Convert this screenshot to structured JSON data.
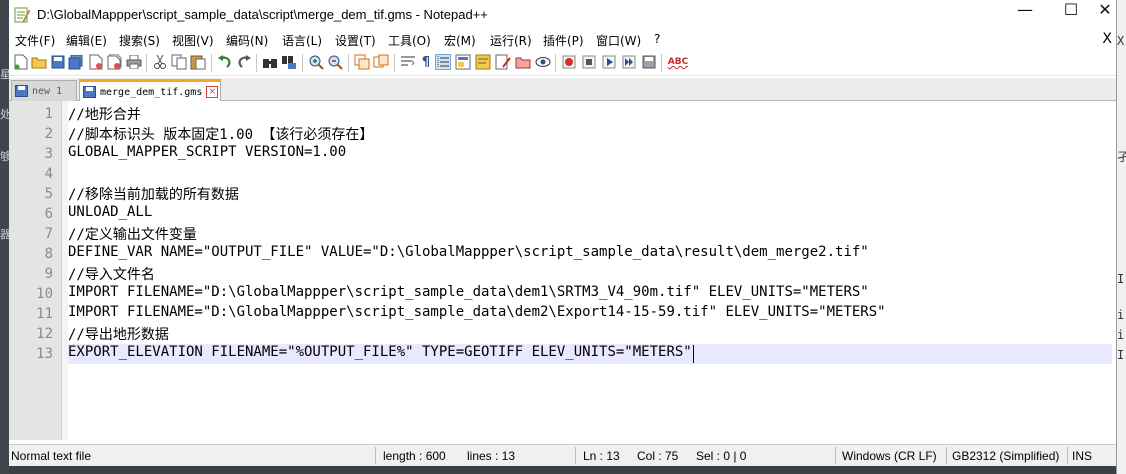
{
  "window": {
    "title": "D:\\GlobalMappper\\script_sample_data\\script\\merge_dem_tif.gms - Notepad++",
    "minimize_glyph": "—",
    "maximize_glyph": "☐",
    "close_glyph": "✕"
  },
  "menu": {
    "items": [
      "文件(F)",
      "编辑(E)",
      "搜索(S)",
      "视图(V)",
      "编码(N)",
      "语言(L)",
      "设置(T)",
      "工具(O)",
      "宏(M)",
      "运行(R)",
      "插件(P)",
      "窗口(W)",
      "?"
    ],
    "close_label": "X"
  },
  "tabs": [
    {
      "label": "new 1",
      "active": false
    },
    {
      "label": "merge_dem_tif.gms",
      "active": true
    }
  ],
  "editor": {
    "line_numbers": [
      "1",
      "2",
      "3",
      "4",
      "5",
      "6",
      "7",
      "8",
      "9",
      "10",
      "11",
      "12",
      "13"
    ],
    "lines": [
      "//地形合并",
      "//脚本标识头 版本固定1.00 【该行必须存在】",
      "GLOBAL_MAPPER_SCRIPT VERSION=1.00",
      "",
      "//移除当前加载的所有数据",
      "UNLOAD_ALL",
      "//定义输出文件变量",
      "DEFINE_VAR NAME=\"OUTPUT_FILE\" VALUE=\"D:\\GlobalMappper\\script_sample_data\\result\\dem_merge2.tif\"",
      "//导入文件名",
      "IMPORT FILENAME=\"D:\\GlobalMappper\\script_sample_data\\dem1\\SRTM3_V4_90m.tif\" ELEV_UNITS=\"METERS\"",
      "IMPORT FILENAME=\"D:\\GlobalMappper\\script_sample_data\\dem2\\Export14-15-59.tif\" ELEV_UNITS=\"METERS\"",
      "//导出地形数据",
      "EXPORT_ELEVATION FILENAME=\"%OUTPUT_FILE%\" TYPE=GEOTIFF ELEV_UNITS=\"METERS\""
    ],
    "current_line": 13
  },
  "status": {
    "file_type": "Normal text file",
    "length": "length : 600",
    "lines": "lines : 13",
    "ln": "Ln : 13",
    "col": "Col : 75",
    "sel": "Sel : 0 | 0",
    "eol": "Windows (CR LF)",
    "encoding": "GB2312 (Simplified)",
    "mode": "INS"
  },
  "toolbar": {
    "icons": [
      "new-file-icon",
      "open-file-icon",
      "save-icon",
      "save-all-icon",
      "close-icon",
      "close-all-icon",
      "print-icon",
      "cut-icon",
      "copy-icon",
      "paste-icon",
      "undo-icon",
      "redo-icon",
      "find-icon",
      "replace-icon",
      "zoom-in-icon",
      "zoom-out-icon",
      "sync-vertical-icon",
      "sync-horizontal-icon",
      "word-wrap-icon",
      "show-all-chars-icon",
      "indent-guide-icon",
      "udl-icon",
      "doc-map-icon",
      "function-list-icon",
      "folder-workspace-icon",
      "monitor-icon",
      "record-macro-icon",
      "stop-macro-icon",
      "play-macro-icon",
      "run-macro-multiple-icon",
      "save-macro-icon",
      "spell-check-icon"
    ],
    "spellcheck_label": "ABC"
  },
  "colors": {
    "current_line": "#e8e8ff",
    "active_tab_accent": "#f5a623",
    "gutter": "#e4e4e4"
  }
}
